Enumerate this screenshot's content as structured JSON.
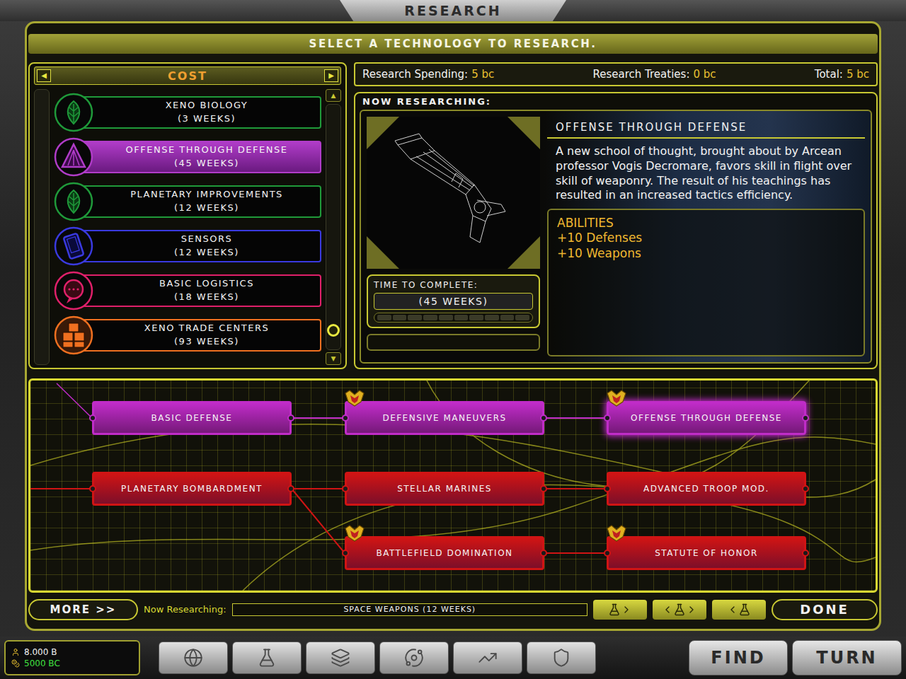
{
  "header": {
    "title": "RESEARCH"
  },
  "instruction": "SELECT A TECHNOLOGY TO RESEARCH.",
  "sort": {
    "label": "COST",
    "prev": "◀",
    "next": "▶"
  },
  "tech_list": {
    "items": [
      {
        "name": "XENO BIOLOGY",
        "cost": "(3 WEEKS)",
        "kind": "leaf",
        "color": "#1f9a3a",
        "selected": false
      },
      {
        "name": "OFFENSE THROUGH DEFENSE",
        "cost": "(45 WEEKS)",
        "kind": "triangle",
        "color": "#b03cc8",
        "selected": true
      },
      {
        "name": "PLANETARY IMPROVEMENTS",
        "cost": "(12 WEEKS)",
        "kind": "leaf",
        "color": "#1f9a3a",
        "selected": false
      },
      {
        "name": "SENSORS",
        "cost": "(12 WEEKS)",
        "kind": "tablet",
        "color": "#3a3ae0",
        "selected": false
      },
      {
        "name": "BASIC LOGISTICS",
        "cost": "(18 WEEKS)",
        "kind": "bubble",
        "color": "#e0206a",
        "selected": false
      },
      {
        "name": "XENO TRADE CENTERS",
        "cost": "(93 WEEKS)",
        "kind": "blocks",
        "color": "#f07020",
        "selected": false
      }
    ],
    "scroll_up": "▲",
    "scroll_down": "▼",
    "scroll_level": 1
  },
  "budget": [
    {
      "label": "Research Spending:",
      "value": "5 bc"
    },
    {
      "label": "Research Treaties:",
      "value": "0 bc"
    },
    {
      "label": "Total:",
      "value": "5 bc"
    }
  ],
  "now_researching": {
    "label": "NOW RESEARCHING:",
    "title": "OFFENSE THROUGH DEFENSE",
    "description": "A new school of thought, brought about by Arcean professor Vogis Decromare, favors skill in flight over skill of weaponry. The result of his teachings has resulted in an increased tactics efficiency.",
    "abilities_title": "ABILITIES",
    "abilities": [
      "+10 Defenses",
      "+10 Weapons"
    ],
    "time_label": "TIME TO COMPLETE:",
    "time": "(45 WEEKS)",
    "level": 0
  },
  "tree": {
    "nodes": [
      {
        "name": "BASIC DEFENSE",
        "color": "#c02cc8",
        "badge": false,
        "selected": false
      },
      {
        "name": "DEFENSIVE MANEUVERS",
        "color": "#c02cc8",
        "badge": true,
        "selected": false
      },
      {
        "name": "OFFENSE THROUGH DEFENSE",
        "color": "#c02cc8",
        "badge": true,
        "selected": true
      },
      {
        "name": "PLANETARY BOMBARDMENT",
        "color": "#d01414",
        "badge": false,
        "selected": false
      },
      {
        "name": "STELLAR MARINES",
        "color": "#d01414",
        "badge": false,
        "selected": false
      },
      {
        "name": "ADVANCED TROOP MOD.",
        "color": "#d01414",
        "badge": false,
        "selected": false
      },
      {
        "name": "BATTLEFIELD DOMINATION",
        "color": "#d01414",
        "badge": true,
        "selected": false
      },
      {
        "name": "STATUTE OF HONOR",
        "color": "#d01414",
        "badge": true,
        "selected": false
      }
    ],
    "links": [
      {
        "from": 0,
        "to": 1
      },
      {
        "from": 1,
        "to": 2
      },
      {
        "from": 3,
        "to": 4
      },
      {
        "from": 4,
        "to": 5
      },
      {
        "from": 3,
        "to": 6
      },
      {
        "from": 6,
        "to": 7
      }
    ]
  },
  "bottom_bar": {
    "more": "MORE >>",
    "now_label": "Now Researching:",
    "now_value": "SPACE WEAPONS (12 WEEKS)",
    "done": "DONE"
  },
  "taskbar": {
    "population": "8.000 B",
    "money": "5000 BC",
    "find": "FIND",
    "turn": "TURN"
  }
}
